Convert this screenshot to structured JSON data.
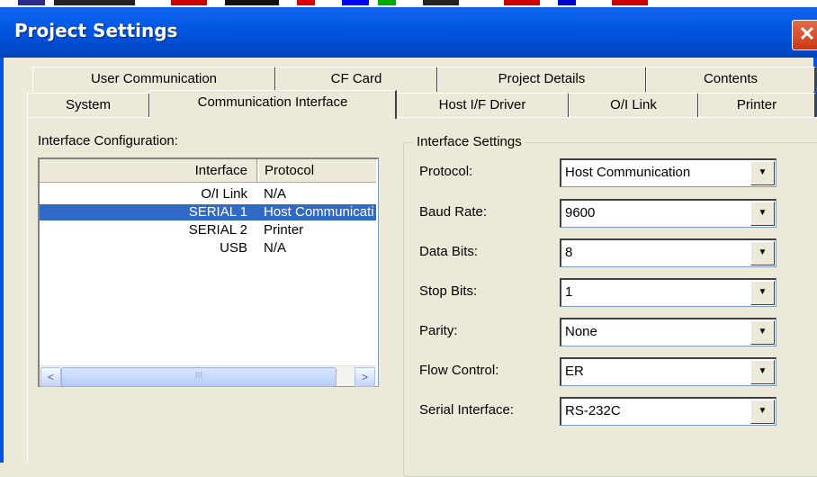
{
  "window": {
    "title": "Project Settings",
    "close": "✕"
  },
  "tabs_row1": [
    {
      "label": "User Communication"
    },
    {
      "label": "CF Card"
    },
    {
      "label": "Project Details"
    },
    {
      "label": "Contents"
    }
  ],
  "tabs_row2": [
    {
      "label": "System"
    },
    {
      "label": "Communication Interface",
      "active": true
    },
    {
      "label": "Host I/F Driver"
    },
    {
      "label": "O/I Link"
    },
    {
      "label": "Printer"
    }
  ],
  "interface_config": {
    "label": "Interface Configuration:",
    "columns": [
      "Interface",
      "Protocol"
    ],
    "rows": [
      {
        "interface": "O/I Link",
        "protocol": "N/A"
      },
      {
        "interface": "SERIAL 1",
        "protocol": "Host Communicati",
        "selected": true
      },
      {
        "interface": "SERIAL 2",
        "protocol": "Printer"
      },
      {
        "interface": "USB",
        "protocol": "N/A"
      }
    ],
    "scroll": {
      "left": "<",
      "right": ">",
      "grip": "III"
    }
  },
  "interface_settings": {
    "label": "Interface Settings",
    "fields": [
      {
        "label": "Protocol:",
        "value": "Host Communication"
      },
      {
        "label": "Baud Rate:",
        "value": "9600"
      },
      {
        "label": "Data Bits:",
        "value": "8"
      },
      {
        "label": "Stop Bits:",
        "value": "1"
      },
      {
        "label": "Parity:",
        "value": "None"
      },
      {
        "label": "Flow Control:",
        "value": "ER"
      },
      {
        "label": "Serial Interface:",
        "value": "RS-232C"
      }
    ],
    "dropdown_arrow": "▼"
  }
}
